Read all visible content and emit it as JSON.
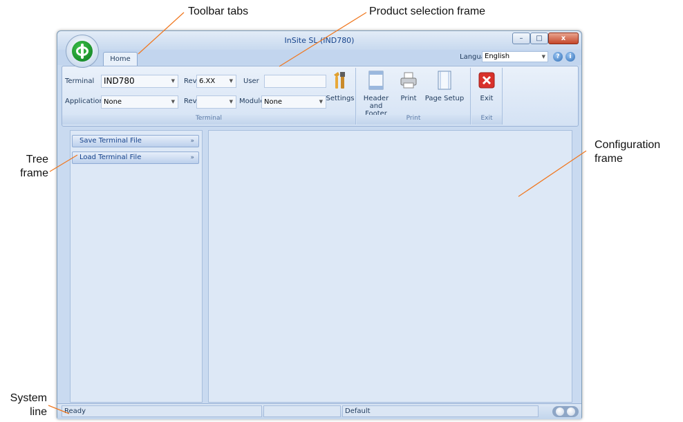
{
  "callouts": {
    "toolbar_tabs": "Toolbar tabs",
    "product_selection": "Product selection frame",
    "tree_frame": "Tree\nframe",
    "configuration_frame": "Configuration\nframe",
    "system_line": "System\nline"
  },
  "window": {
    "title": "InSite SL (IND780)",
    "controls": {
      "minimize": "–",
      "maximize": "□",
      "close": "x"
    }
  },
  "tabs": [
    {
      "label": "Home"
    }
  ],
  "language": {
    "label": "Language",
    "value": "English"
  },
  "ribbon": {
    "terminal_group": {
      "label": "Terminal",
      "terminal_label": "Terminal",
      "terminal_value": "IND780",
      "rev_label": "Rev.",
      "rev_value": "6.XX",
      "user_label": "User",
      "user_value": "",
      "application_label": "Application",
      "application_value": "None",
      "rev2_label": "Rev.",
      "rev2_value": "",
      "module_label": "Module",
      "module_value": "None",
      "settings_label": "Settings"
    },
    "print_group": {
      "label": "Print",
      "header_footer": "Header and\nFooter",
      "print": "Print",
      "page_setup": "Page Setup"
    },
    "exit_group": {
      "label": "Exit",
      "exit": "Exit"
    }
  },
  "tree": {
    "items": [
      {
        "label": "Save Terminal File"
      },
      {
        "label": "Load Terminal File"
      }
    ]
  },
  "status": {
    "left": "Ready",
    "middle": "",
    "right": "Default"
  },
  "colors": {
    "accent_line": "#f07820",
    "exit_red": "#d9312b"
  }
}
